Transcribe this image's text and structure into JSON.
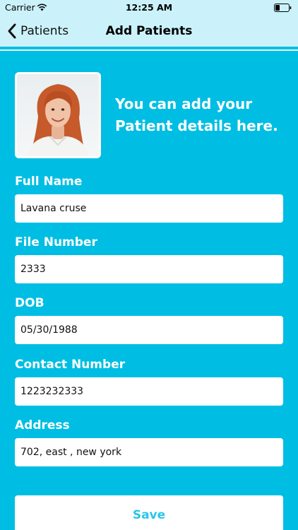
{
  "status": {
    "carrier": "Carrier",
    "time": "12:25 AM"
  },
  "nav": {
    "back_label": "Patients",
    "title": "Add Patients"
  },
  "intro": "You can add your\nPatient details here.",
  "form": {
    "full_name": {
      "label": "Full Name",
      "value": "Lavana cruse"
    },
    "file_number": {
      "label": "File Number",
      "value": "2333"
    },
    "dob": {
      "label": "DOB",
      "value": "05/30/1988"
    },
    "contact_number": {
      "label": "Contact Number",
      "value": "1223232333"
    },
    "address": {
      "label": "Address",
      "value": "702, east , new york"
    }
  },
  "save_label": "Save",
  "colors": {
    "background": "#00BEE3",
    "navbar": "#CBF2FB",
    "accent": "#2AC6E8"
  },
  "icons": [
    "wifi-icon",
    "battery-icon",
    "chevron-left-icon"
  ]
}
